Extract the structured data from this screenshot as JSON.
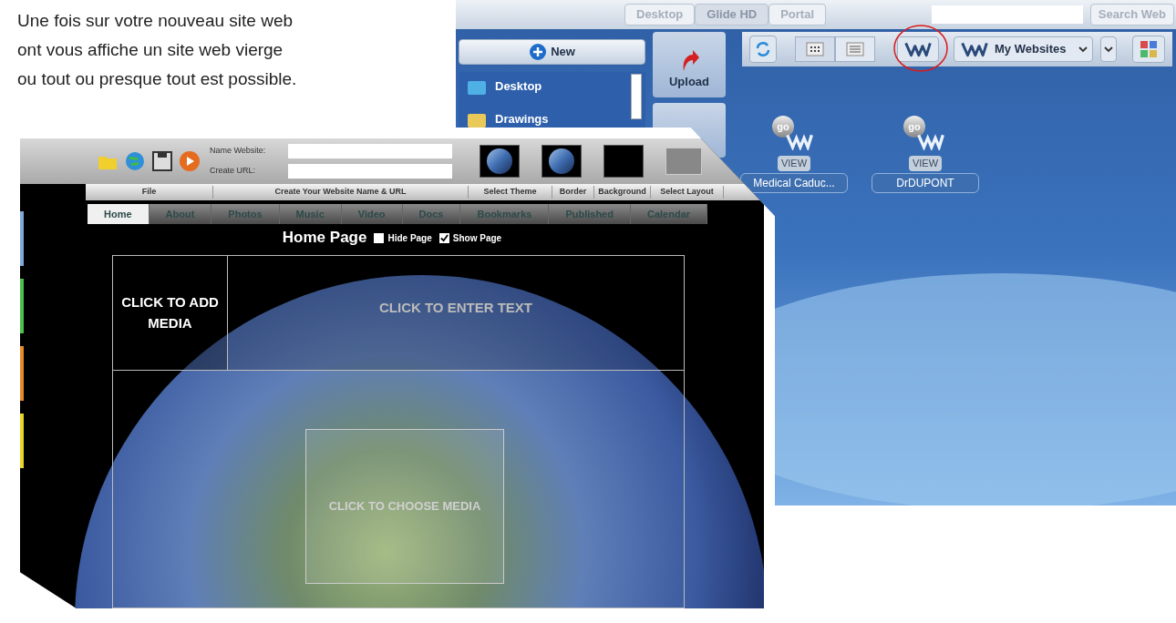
{
  "intro": {
    "lines": [
      "Une fois sur votre nouveau site web",
      "ont vous affiche un site web vierge",
      "ou tout ou presque tout est possible."
    ]
  },
  "desktop_app": {
    "top_tabs": [
      {
        "label": "Desktop",
        "selected": false
      },
      {
        "label": "Glide HD",
        "selected": true
      },
      {
        "label": "Portal",
        "selected": false
      }
    ],
    "search_button": "Search Web",
    "new_button": "New",
    "sidebar_items": [
      "Desktop",
      "Drawings"
    ],
    "upload_button": "Upload",
    "websites_menu": "My Websites",
    "desktop_icons": [
      {
        "go": "go",
        "badge": "VIEW",
        "label": "Medical Caduc..."
      },
      {
        "go": "go",
        "badge": "VIEW",
        "label": "DrDUPONT"
      }
    ]
  },
  "editor": {
    "fields": [
      "Name Website:",
      "Create URL:"
    ],
    "menu": [
      "File",
      "Create Your Website Name & URL",
      "Select Theme",
      "Border",
      "Background",
      "Select Layout"
    ],
    "tabs": [
      {
        "label": "Home",
        "selected": true
      },
      {
        "label": "About",
        "selected": false
      },
      {
        "label": "Photos",
        "selected": false
      },
      {
        "label": "Music",
        "selected": false
      },
      {
        "label": "Video",
        "selected": false
      },
      {
        "label": "Docs",
        "selected": false
      },
      {
        "label": "Bookmarks",
        "selected": false
      },
      {
        "label": "Published",
        "selected": false
      },
      {
        "label": "Calendar",
        "selected": false
      }
    ],
    "page_title": "Home Page",
    "options": [
      {
        "label": "Hide Page",
        "checked": false
      },
      {
        "label": "Show Page",
        "checked": true
      }
    ],
    "blocks": [
      "CLICK TO ADD MEDIA",
      "CLICK TO ENTER TEXT",
      "CLICK TO CHOOSE MEDIA"
    ]
  }
}
